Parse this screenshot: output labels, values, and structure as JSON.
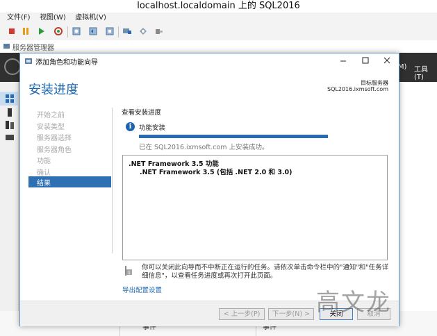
{
  "vm": {
    "title": "localhost.localdomain 上的 SQL2016",
    "menu": [
      "文件(F)",
      "视图(W)",
      "虚拟机(V)"
    ]
  },
  "server_manager": {
    "title": "服务器管理器",
    "menu_right": [
      "(M)",
      "工具(T)"
    ],
    "bottom_labels": [
      "事件",
      "事件"
    ]
  },
  "wizard": {
    "title": "添加角色和功能向导",
    "heading": "安装进度",
    "target_label": "目标服务器",
    "target_value": "SQL2016.ixmsoft.com",
    "steps": [
      "开始之前",
      "安装类型",
      "服务器选择",
      "服务器角色",
      "功能",
      "确认",
      "结果"
    ],
    "active_step": "结果",
    "progress_label": "查看安装进度",
    "feature_label": "功能安装",
    "progress_value": 1.0,
    "success_text": "已在 SQL2016.ixmsoft.com 上安装成功。",
    "results": [
      ".NET Framework 3.5 功能",
      ".NET Framework 3.5 (包括 .NET 2.0 和 3.0)"
    ],
    "note": "你可以关闭此向导而不中断正在运行的任务。请依次单击命令栏中的\"通知\"和\"任务详细信息\"，以查看任务进度或再次打开此页面。",
    "export_link": "导出配置设置",
    "buttons": {
      "prev": "< 上一步(P)",
      "next": "下一步(N) >",
      "close": "关闭",
      "cancel": "取消"
    }
  },
  "watermark": "高文龙",
  "colors": {
    "accent": "#1c67b2",
    "active_step_bg": "#2f6fb4",
    "progress": "#2a6ab3",
    "header_dark": "#303030"
  }
}
